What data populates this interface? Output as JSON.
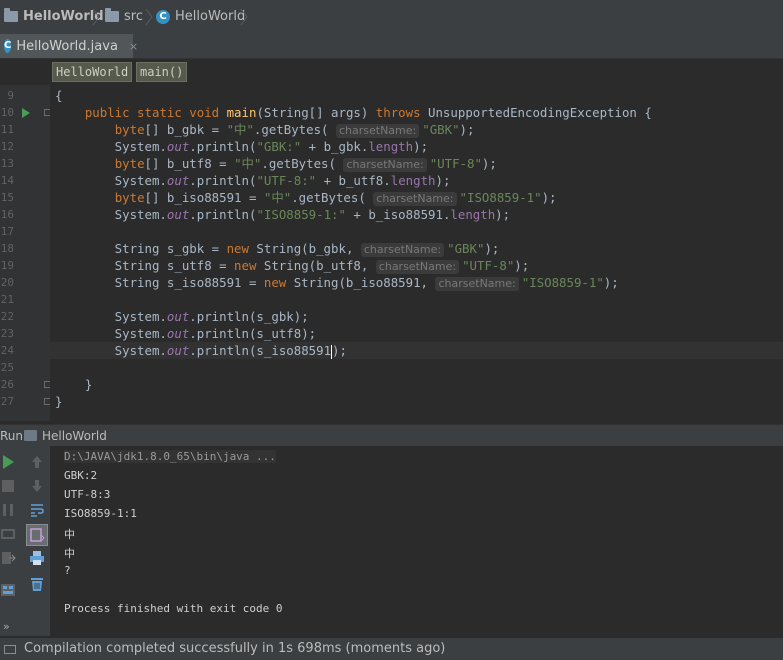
{
  "breadcrumbs": [
    {
      "label": "HelloWorld",
      "icon": "folder-icon"
    },
    {
      "label": "src",
      "icon": "folder-icon"
    },
    {
      "label": "HelloWorld",
      "icon": "class-icon"
    }
  ],
  "class_icon_glyph": "C",
  "tab": {
    "label": "HelloWorld.java",
    "close": "×"
  },
  "editor_crumbs": [
    "HelloWorld",
    "main()"
  ],
  "line_numbers": [
    "9",
    "10",
    "11",
    "12",
    "13",
    "14",
    "15",
    "16",
    "17",
    "18",
    "19",
    "20",
    "21",
    "22",
    "23",
    "24",
    "25",
    "26",
    "27"
  ],
  "code": [
    {
      "tokens": [
        [
          "",
          "{"
        ]
      ]
    },
    {
      "tokens": [
        [
          "",
          "    "
        ],
        [
          "kw",
          "public static void "
        ],
        [
          "fn",
          "main"
        ],
        [
          "",
          "(String[] args) "
        ],
        [
          "kw",
          "throws "
        ],
        [
          "",
          "UnsupportedEncodingException {"
        ]
      ]
    },
    {
      "tokens": [
        [
          "",
          "        "
        ],
        [
          "kw",
          "byte"
        ],
        [
          "",
          "[] b_gbk = "
        ],
        [
          "str",
          "\"中\""
        ],
        [
          "",
          ".getBytes( "
        ],
        [
          "hint",
          "charsetName:"
        ],
        [
          "str",
          "\"GBK\""
        ],
        [
          "",
          ");"
        ]
      ]
    },
    {
      "tokens": [
        [
          "",
          "        System."
        ],
        [
          "it",
          "out"
        ],
        [
          "",
          ".println("
        ],
        [
          "str",
          "\"GBK:\""
        ],
        [
          "",
          " + b_gbk."
        ],
        [
          "fld",
          "length"
        ],
        [
          "",
          ");"
        ]
      ]
    },
    {
      "tokens": [
        [
          "",
          "        "
        ],
        [
          "kw",
          "byte"
        ],
        [
          "",
          "[] b_utf8 = "
        ],
        [
          "str",
          "\"中\""
        ],
        [
          "",
          ".getBytes( "
        ],
        [
          "hint",
          "charsetName:"
        ],
        [
          "str",
          "\"UTF-8\""
        ],
        [
          "",
          ");"
        ]
      ]
    },
    {
      "tokens": [
        [
          "",
          "        System."
        ],
        [
          "it",
          "out"
        ],
        [
          "",
          ".println("
        ],
        [
          "str",
          "\"UTF-8:\""
        ],
        [
          "",
          " + b_utf8."
        ],
        [
          "fld",
          "length"
        ],
        [
          "",
          ");"
        ]
      ]
    },
    {
      "tokens": [
        [
          "",
          "        "
        ],
        [
          "kw",
          "byte"
        ],
        [
          "",
          "[] b_iso88591 = "
        ],
        [
          "str",
          "\"中\""
        ],
        [
          "",
          ".getBytes( "
        ],
        [
          "hint",
          "charsetName:"
        ],
        [
          "str",
          "\"ISO8859-1\""
        ],
        [
          "",
          ");"
        ]
      ]
    },
    {
      "tokens": [
        [
          "",
          "        System."
        ],
        [
          "it",
          "out"
        ],
        [
          "",
          ".println("
        ],
        [
          "str",
          "\"ISO8859-1:\""
        ],
        [
          "",
          " + b_iso88591."
        ],
        [
          "fld",
          "length"
        ],
        [
          "",
          ");"
        ]
      ]
    },
    {
      "tokens": [
        [
          "",
          ""
        ]
      ]
    },
    {
      "tokens": [
        [
          "",
          "        String s_gbk = "
        ],
        [
          "kw",
          "new "
        ],
        [
          "",
          "String(b_gbk, "
        ],
        [
          "hint",
          "charsetName:"
        ],
        [
          "str",
          "\"GBK\""
        ],
        [
          "",
          ");"
        ]
      ]
    },
    {
      "tokens": [
        [
          "",
          "        String s_utf8 = "
        ],
        [
          "kw",
          "new "
        ],
        [
          "",
          "String(b_utf8, "
        ],
        [
          "hint",
          "charsetName:"
        ],
        [
          "str",
          "\"UTF-8\""
        ],
        [
          "",
          ");"
        ]
      ]
    },
    {
      "tokens": [
        [
          "",
          "        String s_iso88591 = "
        ],
        [
          "kw",
          "new "
        ],
        [
          "",
          "String(b_iso88591, "
        ],
        [
          "hint",
          "charsetName:"
        ],
        [
          "str",
          "\"ISO8859-1\""
        ],
        [
          "",
          ");"
        ]
      ]
    },
    {
      "tokens": [
        [
          "",
          ""
        ]
      ]
    },
    {
      "tokens": [
        [
          "",
          "        System."
        ],
        [
          "it",
          "out"
        ],
        [
          "",
          ".println(s_gbk);"
        ]
      ]
    },
    {
      "tokens": [
        [
          "",
          "        System."
        ],
        [
          "it",
          "out"
        ],
        [
          "",
          ".println(s_utf8);"
        ]
      ]
    },
    {
      "tokens": [
        [
          "",
          "        System."
        ],
        [
          "it",
          "out"
        ],
        [
          "",
          ".println(s_iso88591"
        ],
        [
          "caret",
          ""
        ],
        [
          "",
          ");"
        ]
      ]
    },
    {
      "tokens": [
        [
          "",
          ""
        ]
      ]
    },
    {
      "tokens": [
        [
          "",
          "    }"
        ]
      ]
    },
    {
      "tokens": [
        [
          "",
          "}"
        ]
      ]
    }
  ],
  "run": {
    "label": "Run",
    "config": "HelloWorld"
  },
  "console": [
    "D:\\JAVA\\jdk1.8.0_65\\bin\\java ...",
    "GBK:2",
    "UTF-8:3",
    "ISO8859-1:1",
    "中",
    "中",
    "?",
    "",
    "Process finished with exit code 0"
  ],
  "status": "Compilation completed successfully in 1s 698ms (moments ago)",
  "colors": {
    "keyword": "#cc7832",
    "string": "#6a8759",
    "method": "#ffc66d",
    "static_field": "#9876aa",
    "run_green": "#499c54"
  }
}
